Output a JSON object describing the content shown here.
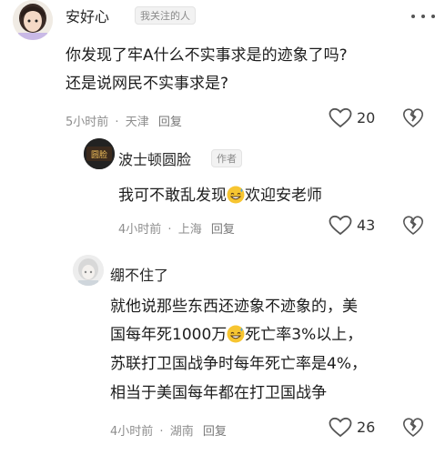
{
  "comments": [
    {
      "user": "安好心",
      "tag": "我关注的人",
      "lines": [
        "你发现了牢A什么不实事求是的迹象了吗?",
        "还是说网民不实事求是?"
      ],
      "time": "5小时前",
      "location": "天津",
      "reply_label": "回复",
      "likes": "20"
    },
    {
      "user": "波士顿圆脸",
      "tag": "作者",
      "avatar_text": "圆脸",
      "text_before": "我可不敢乱发现",
      "text_after": "欢迎安老师",
      "time": "4小时前",
      "location": "上海",
      "reply_label": "回复",
      "likes": "43"
    },
    {
      "user": "绷不住了",
      "line1": "就他说那些东西还迹象不迹象的，美",
      "line2_before": "国每年死1000万",
      "line2_after": "死亡率3%以上，",
      "line3": "苏联打卫国战争时每年死亡率是4%，",
      "line4": "相当于美国每年都在打卫国战争",
      "time": "4小时前",
      "location": "湖南",
      "reply_label": "回复",
      "likes": "26"
    }
  ],
  "separator": "·"
}
